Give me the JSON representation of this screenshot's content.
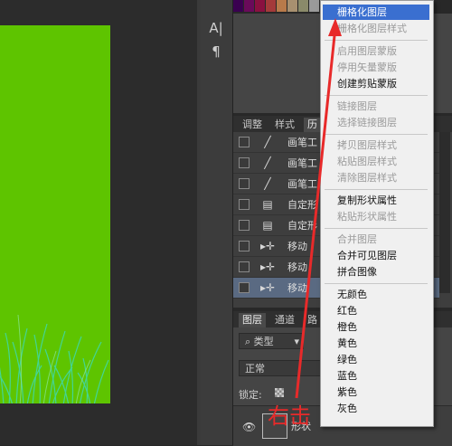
{
  "canvas": {
    "bg_color": "#5ec400"
  },
  "toolstrip": {
    "text_tool_icon": "text-icon",
    "paragraph_tool_icon": "paragraph-icon",
    "text_glyph": "A|",
    "paragraph_glyph": "¶"
  },
  "swatches": [
    "#3a0050",
    "#6a0a5a",
    "#8a1040",
    "#a43a3a",
    "#b87a4a",
    "#a89070",
    "#8a8a6a",
    "#9a9a9a"
  ],
  "history_panel": {
    "tabs": [
      "调整",
      "样式",
      "历"
    ],
    "rows": [
      {
        "label": "画笔工",
        "icon": "brush-icon",
        "glyph": "╱"
      },
      {
        "label": "画笔工",
        "icon": "brush-icon",
        "glyph": "╱"
      },
      {
        "label": "画笔工",
        "icon": "brush-icon",
        "glyph": "╱"
      },
      {
        "label": "自定形",
        "icon": "document-icon",
        "glyph": "▤"
      },
      {
        "label": "自定形",
        "icon": "document-icon",
        "glyph": "▤"
      },
      {
        "label": "移动",
        "icon": "move-icon",
        "glyph": "▸✛"
      },
      {
        "label": "移动",
        "icon": "move-icon",
        "glyph": "▸✛"
      },
      {
        "label": "移动",
        "icon": "move-icon",
        "glyph": "▸✛"
      }
    ]
  },
  "layers_panel": {
    "tabs": [
      "图层",
      "通道",
      "路"
    ],
    "filter": "类型",
    "blend_mode": "正常",
    "lock_label": "锁定:",
    "layer_name": "形状"
  },
  "context_menu": {
    "items": [
      {
        "label": "栅格化图层",
        "disabled": false,
        "highlighted": true
      },
      {
        "label": "栅格化图层样式",
        "disabled": true
      },
      {
        "sep": true
      },
      {
        "label": "启用图层蒙版",
        "disabled": true
      },
      {
        "label": "停用矢量蒙版",
        "disabled": true
      },
      {
        "label": "创建剪贴蒙版",
        "disabled": false
      },
      {
        "sep": true
      },
      {
        "label": "链接图层",
        "disabled": true
      },
      {
        "label": "选择链接图层",
        "disabled": true
      },
      {
        "sep": true
      },
      {
        "label": "拷贝图层样式",
        "disabled": true
      },
      {
        "label": "粘贴图层样式",
        "disabled": true
      },
      {
        "label": "清除图层样式",
        "disabled": true
      },
      {
        "sep": true
      },
      {
        "label": "复制形状属性",
        "disabled": false
      },
      {
        "label": "粘贴形状属性",
        "disabled": true
      },
      {
        "sep": true
      },
      {
        "label": "合并图层",
        "disabled": true
      },
      {
        "label": "合并可见图层",
        "disabled": false
      },
      {
        "label": "拼合图像",
        "disabled": false
      },
      {
        "sep": true
      },
      {
        "label": "无颜色",
        "disabled": false
      },
      {
        "label": "红色",
        "disabled": false
      },
      {
        "label": "橙色",
        "disabled": false
      },
      {
        "label": "黄色",
        "disabled": false
      },
      {
        "label": "绿色",
        "disabled": false
      },
      {
        "label": "蓝色",
        "disabled": false
      },
      {
        "label": "紫色",
        "disabled": false
      },
      {
        "label": "灰色",
        "disabled": false
      }
    ]
  },
  "annotation": {
    "text": "右击",
    "color": "#e82a2a"
  }
}
